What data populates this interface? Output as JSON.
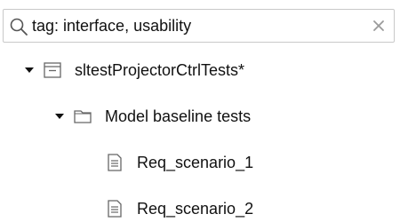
{
  "search": {
    "value": "tag: interface, usability",
    "clear_symbol": "×"
  },
  "tree": {
    "suite": {
      "label": "sltestProjectorCtrlTests*",
      "expanded": true,
      "icon": "test-file-icon"
    },
    "group": {
      "label": "Model baseline tests",
      "expanded": true,
      "icon": "folder-icon"
    },
    "cases": [
      {
        "label": "Req_scenario_1",
        "icon": "test-case-icon"
      },
      {
        "label": "Req_scenario_2",
        "icon": "test-case-icon"
      }
    ]
  },
  "colors": {
    "icon_gray": "#6b6b6b",
    "border": "#c9c9c9",
    "text": "#111111"
  }
}
